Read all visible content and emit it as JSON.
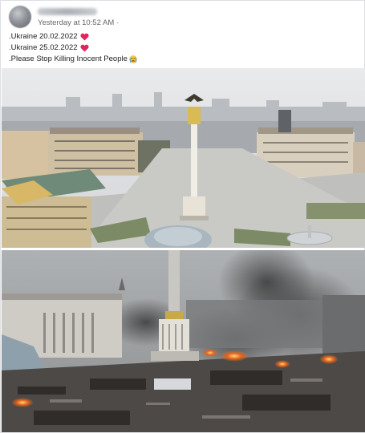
{
  "post": {
    "timestamp": "Yesterday at 10:52 AM",
    "audience_separator": "·",
    "lines": [
      {
        "text": ".Ukraine 20.02.2022",
        "emoji": "red-heart"
      },
      {
        "text": ".Ukraine 25.02.2022",
        "emoji": "red-heart"
      },
      {
        "text": ".Please Stop Killing Inocent People",
        "emoji": "crying-face"
      }
    ]
  },
  "colors": {
    "heart": "#e0245e",
    "emoji_face": "#f7c948",
    "timestamp": "#65676b",
    "text": "#1c1e21"
  }
}
